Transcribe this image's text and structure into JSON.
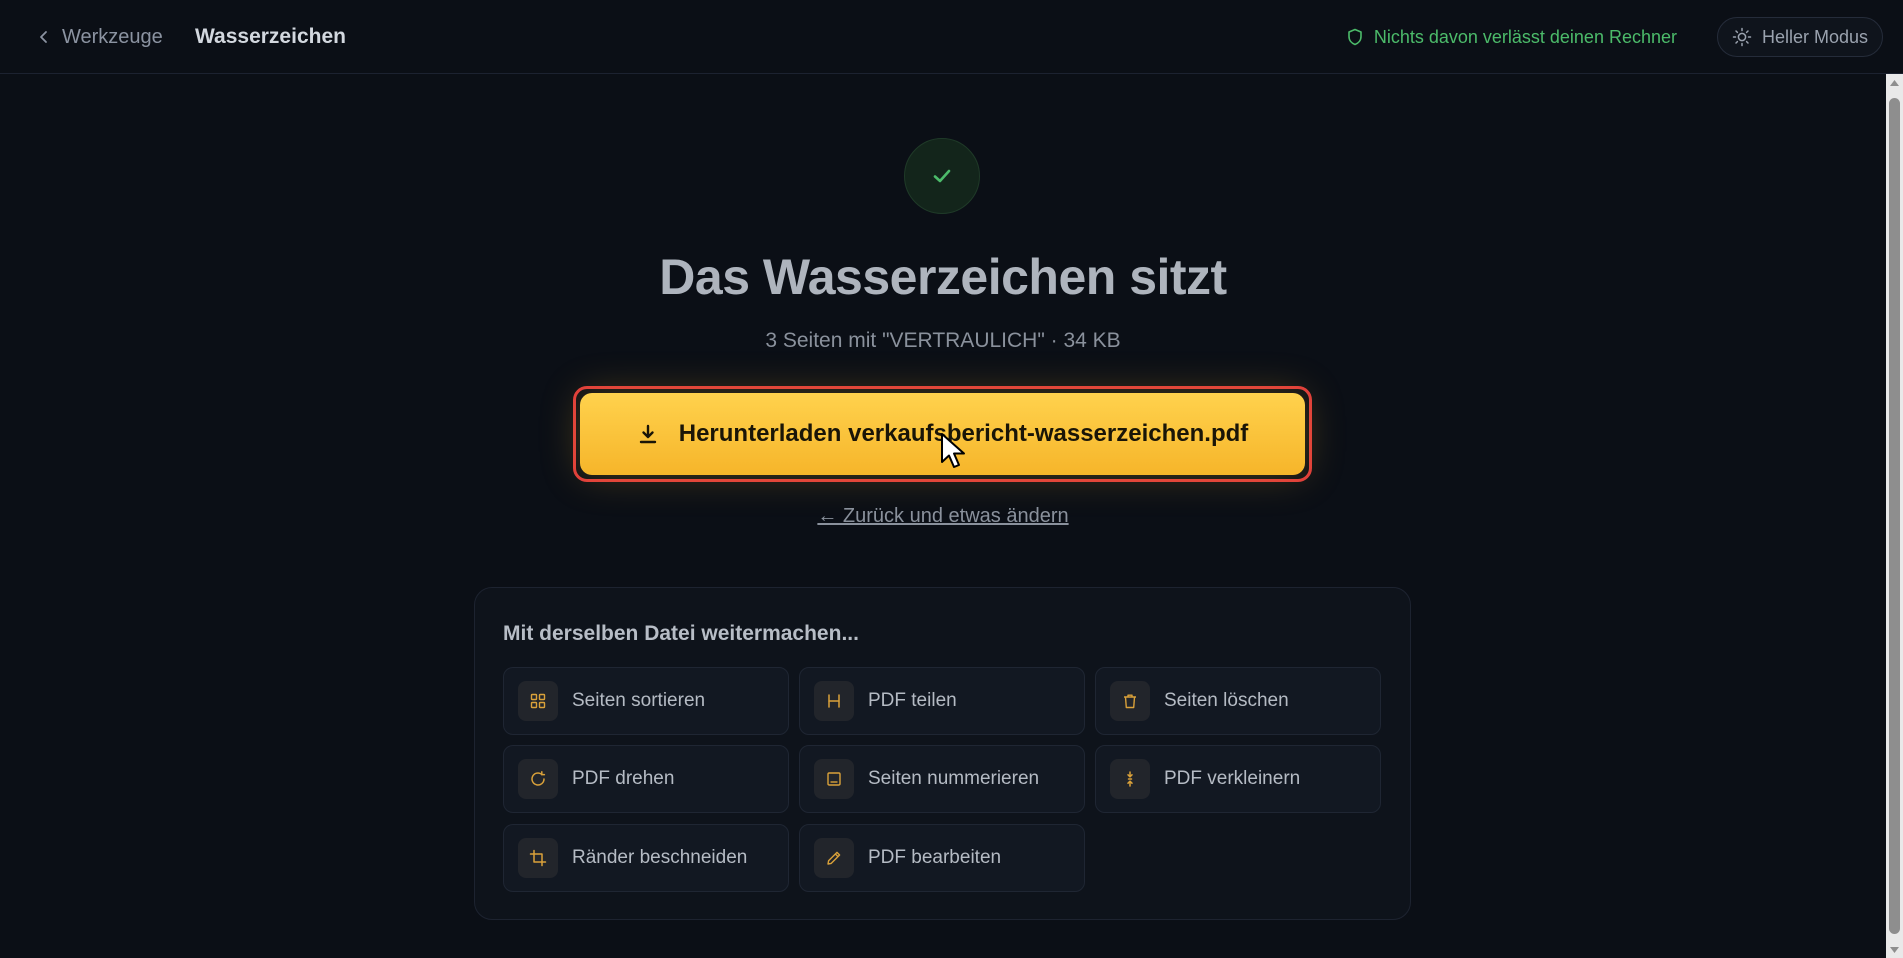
{
  "header": {
    "back_label": "Werkzeuge",
    "title": "Wasserzeichen",
    "privacy_text": "Nichts davon verlässt deinen Rechner",
    "mode_label": "Heller Modus"
  },
  "main": {
    "headline": "Das Wasserzeichen sitzt",
    "subline": "3 Seiten mit \"VERTRAULICH\" · 34 KB",
    "download_label": "Herunterladen verkaufsbericht-wasserzeichen.pdf",
    "back_change_label": "← Zurück und etwas ändern"
  },
  "more": {
    "title": "Mit derselben Datei weitermachen...",
    "tools": [
      {
        "label": "Seiten sortieren",
        "icon": "grid-icon"
      },
      {
        "label": "PDF teilen",
        "icon": "split-icon"
      },
      {
        "label": "Seiten löschen",
        "icon": "trash-icon"
      },
      {
        "label": "PDF drehen",
        "icon": "rotate-icon"
      },
      {
        "label": "Seiten nummerieren",
        "icon": "page-number-icon"
      },
      {
        "label": "PDF verkleinern",
        "icon": "compress-icon"
      },
      {
        "label": "Ränder beschneiden",
        "icon": "crop-icon"
      },
      {
        "label": "PDF bearbeiten",
        "icon": "pencil-icon"
      }
    ]
  },
  "colors": {
    "accent": "#f6b52a",
    "success": "#4cbb6a",
    "background": "#0b0f16",
    "highlight": "#e03c3c"
  }
}
